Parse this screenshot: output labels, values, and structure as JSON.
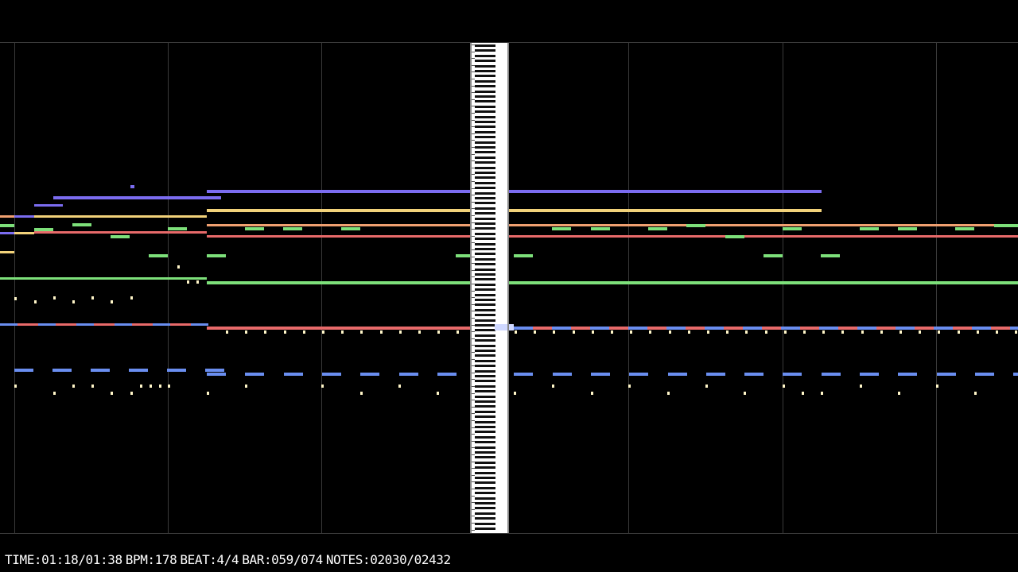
{
  "status": {
    "time": "TIME:01:18/01:38",
    "bpm": "BPM:178",
    "beat": "BEAT:4/4",
    "bar": "BAR:059/074",
    "notes": "NOTES:02030/02432"
  },
  "colors": {
    "background": "#000000",
    "grid": "#3a3a3a",
    "purple": "#7b6cf0",
    "yellow": "#f2d27a",
    "orange": "#f0a070",
    "red": "#e86a6a",
    "green": "#7de07a",
    "blue": "#6a8ef0",
    "dot": "#fff6c8",
    "key_white": "#ffffff",
    "key_black": "#111111",
    "key_highlight": "#cfd8ff"
  },
  "icons": [
    "piano-keyboard-icon"
  ]
}
